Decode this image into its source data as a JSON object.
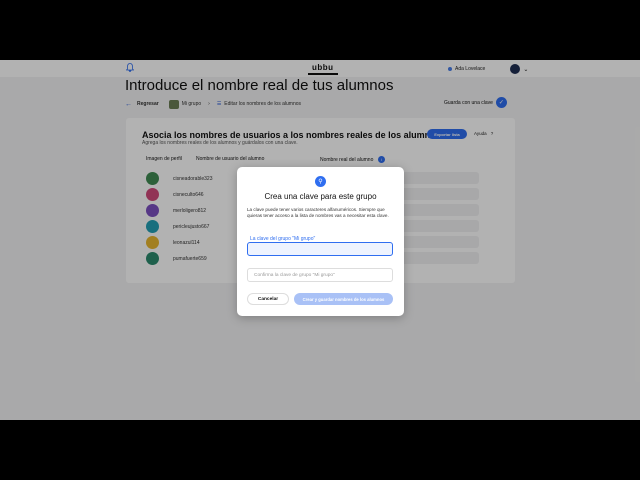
{
  "topbar": {
    "logo": "ubbu",
    "user_name": "Ada Lovelace"
  },
  "page": {
    "title": "Introduce el nombre real de tus alumnos",
    "back_label": "Regresar",
    "group_name": "Mi grupo",
    "edit_label": "Editar los nombres de los alumnos",
    "save_label": "Guarda con una clave"
  },
  "card": {
    "title": "Asocia los nombres de usuarios a los nombres reales de los alumnos.",
    "subtitle": "Agrega los nombres reales de los alumnos y guárdalos con una clave.",
    "export_label": "Exportar lista",
    "help_label": "Ayuda",
    "help_icon": "?",
    "columns": [
      "Imagen de perfil",
      "Nombre de usuario del alumno",
      "Nombre real del alumno"
    ],
    "info_icon": "i",
    "rows": [
      {
        "username": "cisneadorable323",
        "avatar_color": "#3f8a52"
      },
      {
        "username": "cisneculto646",
        "avatar_color": "#d04a7a"
      },
      {
        "username": "merloligero812",
        "avatar_color": "#7b4fc0"
      },
      {
        "username": "pericleujusto667",
        "avatar_color": "#23a0b5"
      },
      {
        "username": "leonazul114",
        "avatar_color": "#e8b62f"
      },
      {
        "username": "pumafuerte659",
        "avatar_color": "#2b8a6e"
      }
    ]
  },
  "modal": {
    "title": "Crea una clave para este grupo",
    "description": "La clave puede tener varios caracteres alfanuméricos. Siempre que quieras tener acceso a la lista de nombres vas a necesitar esta clave.",
    "key_label": "La clave del grupo \"Mi grupo\"",
    "key_value": "",
    "confirm_placeholder": "Confirma la clave de grupo \"Mi grupo\"",
    "cancel_label": "Cancelar",
    "create_label": "Crear y guardar nombres de los alumnos"
  },
  "colors": {
    "accent": "#2f6ef0",
    "overlay": "rgba(0,0,0,0.30)",
    "disabled_button": "#a9c1f6"
  },
  "icons": {
    "bell": "bell-icon",
    "back": "arrow-left-icon",
    "edit": "list-edit-icon",
    "save": "check-icon",
    "lock": "lock-icon",
    "chevron": "chevron-down-icon"
  }
}
